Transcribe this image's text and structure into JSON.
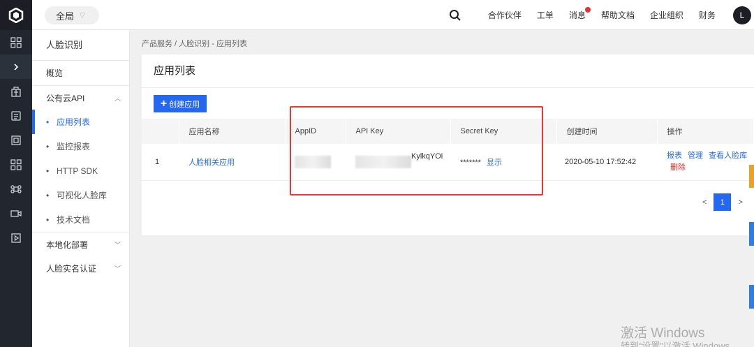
{
  "topbar": {
    "scope_label": "全局",
    "nav": [
      {
        "label": "合作伙伴"
      },
      {
        "label": "工单"
      },
      {
        "label": "消息",
        "has_dot": true
      },
      {
        "label": "帮助文档"
      },
      {
        "label": "企业组织"
      },
      {
        "label": "财务"
      }
    ],
    "avatar_letter": "L"
  },
  "rail": {
    "icons": [
      "logo-icon",
      "grid-icon",
      "expand-chevron-icon",
      "building-icon",
      "document-icon",
      "frame-icon",
      "apps-icon",
      "command-icon",
      "camera-icon",
      "play-icon"
    ]
  },
  "sidebar": {
    "title": "人脸识别",
    "overview": "概览",
    "group_api": "公有云API",
    "sub_items": [
      "应用列表",
      "监控报表",
      "HTTP SDK",
      "可视化人脸库",
      "技术文档"
    ],
    "active_index": 0,
    "group_local": "本地化部署",
    "group_verify": "人脸实名认证"
  },
  "breadcrumb": "产品服务 / 人脸识别 - 应用列表",
  "page_title": "应用列表",
  "create_button": "创建应用",
  "table": {
    "columns": [
      "",
      "应用名称",
      "AppID",
      "API Key",
      "Secret Key",
      "创建时间",
      "操作"
    ],
    "rows": [
      {
        "index": "1",
        "name": "人脸相关应用",
        "api_key_suffix": "KylkqYOi",
        "secret_key": "*******",
        "show_label": "显示",
        "created": "2020-05-10 17:52:42",
        "actions": [
          "报表",
          "管理",
          "查看人脸库",
          "删除"
        ]
      }
    ]
  },
  "pagination": {
    "prev": "<",
    "current": "1",
    "next": ">"
  },
  "watermark": {
    "line1": "激活 Windows",
    "line2": "转到“设置”以激活 Windows"
  },
  "colors": {
    "accent": "#2468f2",
    "highlight_box": "#e53935",
    "rail_bg": "#22272f"
  }
}
